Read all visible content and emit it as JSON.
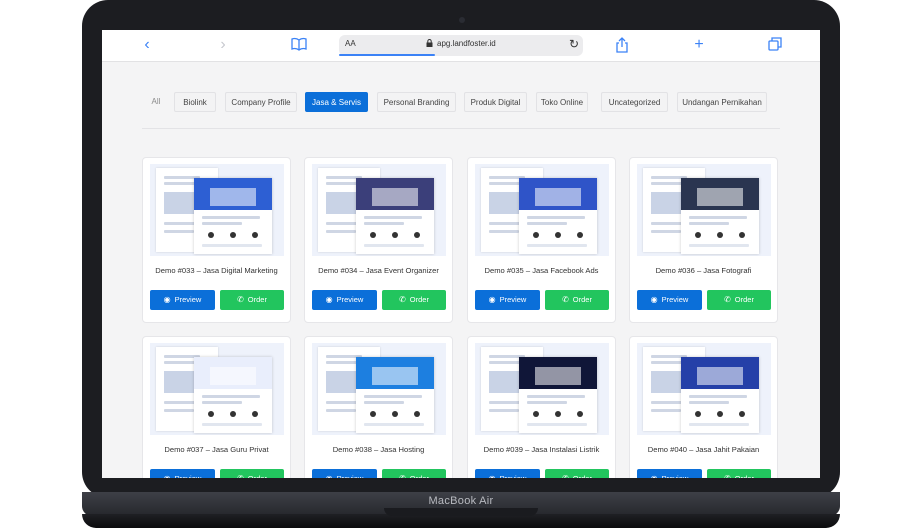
{
  "device": {
    "brand_label": "MacBook Air"
  },
  "browser": {
    "aa_label": "AA",
    "url": "apg.landfoster.id",
    "icons": [
      "back-icon",
      "forward-icon",
      "bookmarks-icon",
      "lock-icon",
      "reload-icon",
      "share-icon",
      "new-tab-icon",
      "tabs-icon"
    ]
  },
  "filters": [
    {
      "label": "All",
      "state": "plain"
    },
    {
      "label": "Biolink",
      "state": "normal"
    },
    {
      "label": "Company Profile",
      "state": "normal"
    },
    {
      "label": "Jasa & Servis",
      "state": "active"
    },
    {
      "label": "Personal Branding",
      "state": "normal"
    },
    {
      "label": "Produk Digital",
      "state": "normal"
    },
    {
      "label": "Toko Online",
      "state": "normal"
    },
    {
      "label": "Uncategorized",
      "state": "normal"
    },
    {
      "label": "Undangan Pernikahan",
      "state": "normal"
    }
  ],
  "cards": [
    {
      "title": "Demo #033 – Jasa Digital Marketing",
      "preview": "Preview",
      "order": "Order",
      "hero_color": "#2d5fd3"
    },
    {
      "title": "Demo #034 – Jasa Event Organizer",
      "preview": "Preview",
      "order": "Order",
      "hero_color": "#3b3f7a"
    },
    {
      "title": "Demo #035 – Jasa Facebook Ads",
      "preview": "Preview",
      "order": "Order",
      "hero_color": "#2f54c8"
    },
    {
      "title": "Demo #036 – Jasa Fotografi",
      "preview": "Preview",
      "order": "Order",
      "hero_color": "#2a3550"
    },
    {
      "title": "Demo #037 – Jasa Guru Privat",
      "preview": "Preview",
      "order": "Order",
      "hero_color": "#e9eefc"
    },
    {
      "title": "Demo #038 – Jasa Hosting",
      "preview": "Preview",
      "order": "Order",
      "hero_color": "#1d7fe0"
    },
    {
      "title": "Demo #039 – Jasa Instalasi Listrik",
      "preview": "Preview",
      "order": "Order",
      "hero_color": "#101638"
    },
    {
      "title": "Demo #040 – Jasa Jahit Pakaian",
      "preview": "Preview",
      "order": "Order",
      "hero_color": "#2540a8"
    }
  ],
  "colors": {
    "primary": "#0b6fd9",
    "whatsapp": "#22c55e",
    "safari_blue": "#3b82f6"
  }
}
